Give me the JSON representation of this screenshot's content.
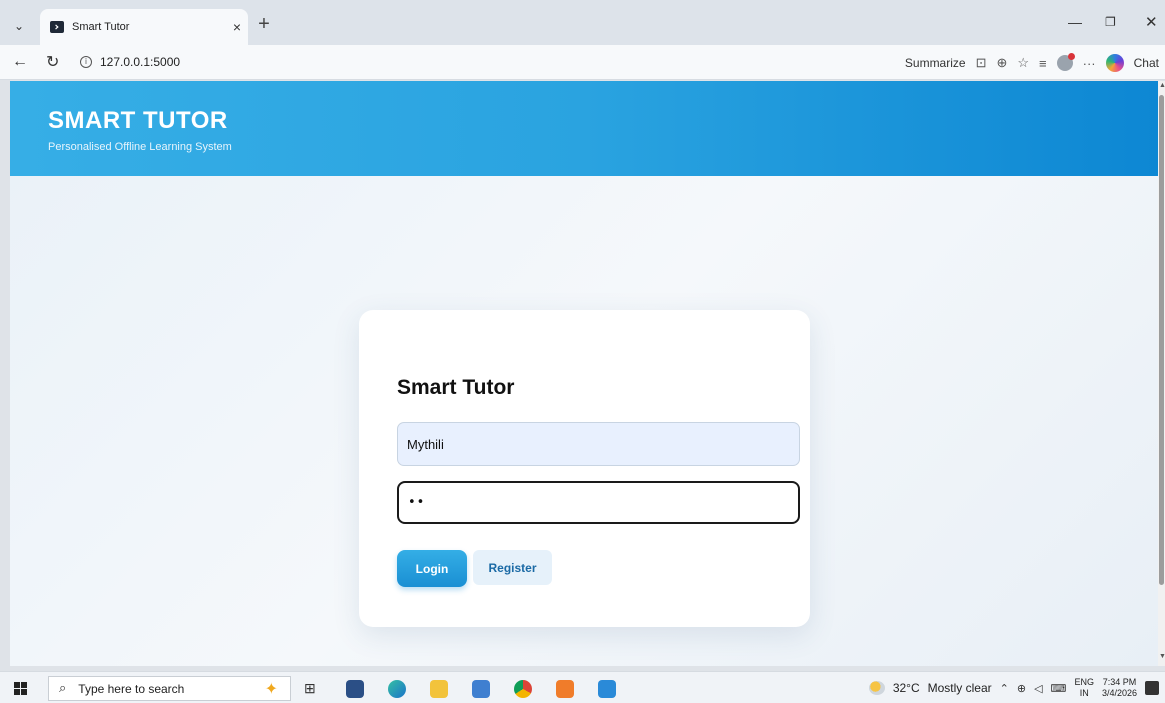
{
  "browser": {
    "tab_title": "Smart Tutor",
    "tab_close": "×",
    "new_tab": "+",
    "url": "127.0.0.1:5000",
    "summarize_label": "Summarize",
    "chat_label": "Chat",
    "more_label": "···"
  },
  "header": {
    "title": "SMART TUTOR",
    "subtitle": "Personalised Offline Learning System"
  },
  "login": {
    "title": "Smart Tutor",
    "username_value": "Mythili",
    "password_mask": "••",
    "login_label": "Login",
    "register_label": "Register"
  },
  "taskbar": {
    "search_placeholder": "Type here to search",
    "temperature": "32°C",
    "weather": "Mostly clear",
    "lang_top": "ENG",
    "lang_bottom": "IN",
    "time": "7:34 PM",
    "date": "3/4/2026"
  },
  "colors": {
    "header_start": "#36aee6",
    "header_end": "#0d87d3",
    "login_button": "#1a8fd3",
    "register_button_bg": "#e6f1fa"
  },
  "icons": [
    "tab-list-icon",
    "favicon-icon",
    "back-icon",
    "refresh-icon",
    "info-icon",
    "immersive-reader-icon",
    "zoom-icon",
    "favorite-star-icon",
    "favorites-list-icon",
    "profile-icon",
    "copilot-icon",
    "windows-start-icon",
    "search-icon",
    "task-view-icon"
  ]
}
